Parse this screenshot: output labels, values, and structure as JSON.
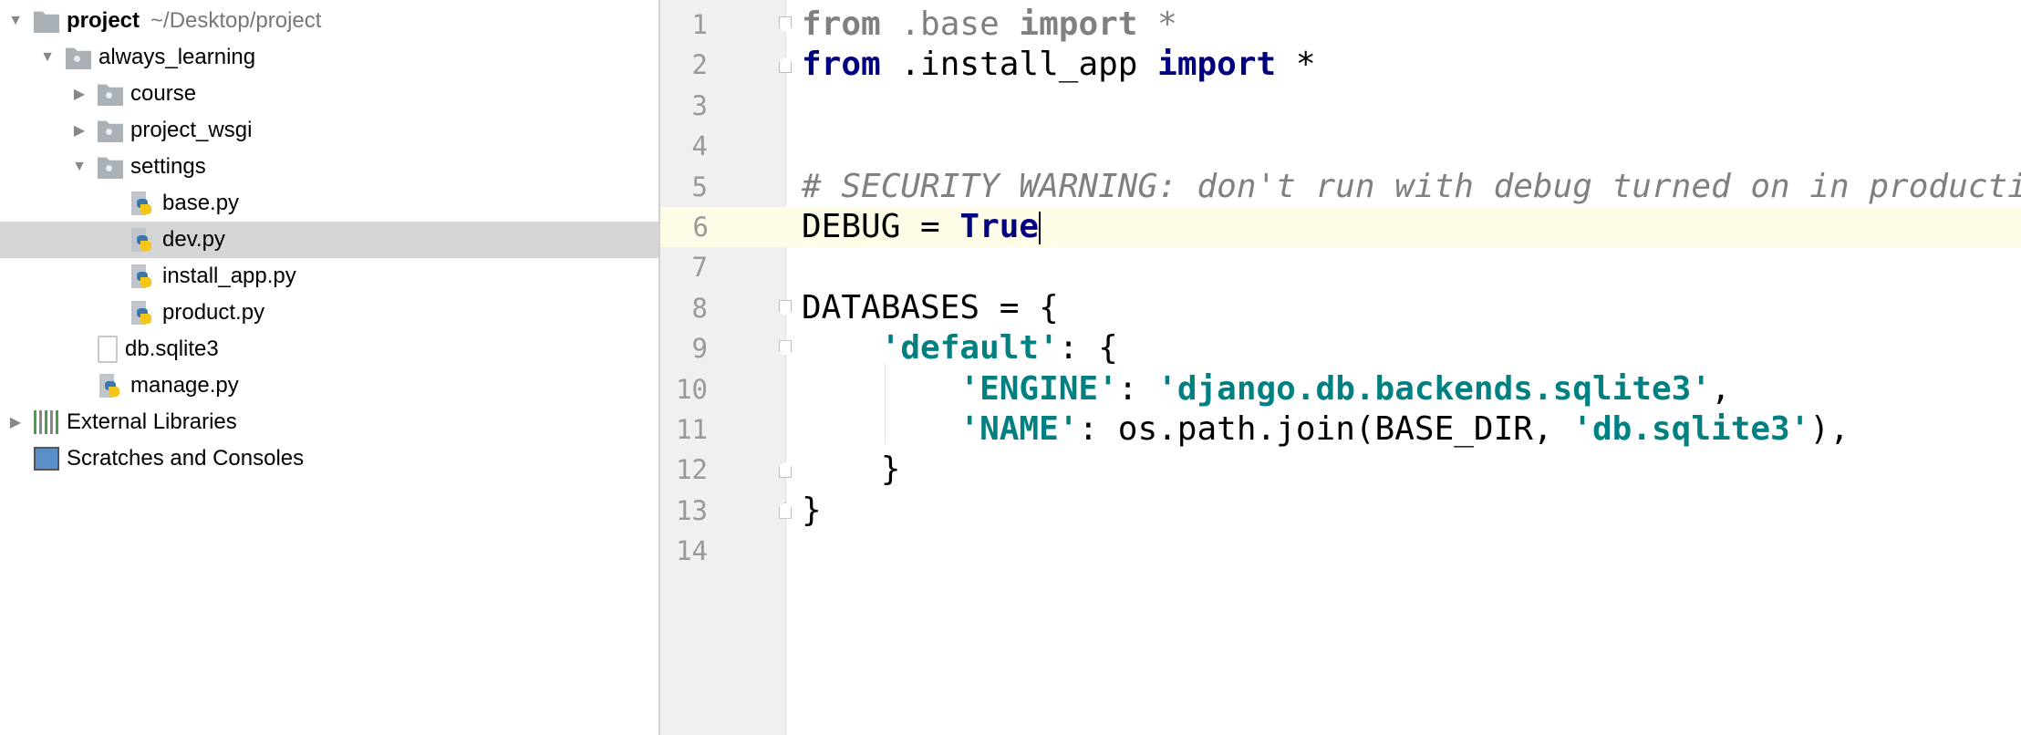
{
  "tree": [
    {
      "label": "project",
      "hint": "~/Desktop/project",
      "arrow": "▼",
      "icon": "folder-icon",
      "level": 0,
      "bold": true
    },
    {
      "label": "always_learning",
      "arrow": "▼",
      "icon": "package-folder-icon",
      "level": 1
    },
    {
      "label": "course",
      "arrow": "▶",
      "icon": "package-folder-icon",
      "level": 2
    },
    {
      "label": "project_wsgi",
      "arrow": "▶",
      "icon": "package-folder-icon",
      "level": 2
    },
    {
      "label": "settings",
      "arrow": "▼",
      "icon": "package-folder-icon",
      "level": 2
    },
    {
      "label": "base.py",
      "arrow": "",
      "icon": "python-file-icon",
      "level": 3
    },
    {
      "label": "dev.py",
      "arrow": "",
      "icon": "python-file-icon",
      "level": 3,
      "selected": true
    },
    {
      "label": "install_app.py",
      "arrow": "",
      "icon": "python-file-icon",
      "level": 3
    },
    {
      "label": "product.py",
      "arrow": "",
      "icon": "python-file-icon",
      "level": 3
    },
    {
      "label": "db.sqlite3",
      "arrow": "",
      "icon": "file-icon",
      "level": 2
    },
    {
      "label": "manage.py",
      "arrow": "",
      "icon": "python-file-icon",
      "level": 2
    },
    {
      "label": "External Libraries",
      "arrow": "▶",
      "icon": "libraries-icon",
      "level": 0
    },
    {
      "label": "Scratches and Consoles",
      "arrow": "",
      "icon": "scratches-icon",
      "level": 0
    }
  ],
  "editor": {
    "current_line": 6,
    "lines": [
      [
        [
          "kwg",
          "from"
        ],
        [
          "gray",
          " .base "
        ],
        [
          "kwg",
          "import"
        ],
        [
          "gray",
          " *"
        ]
      ],
      [
        [
          "kw",
          "from"
        ],
        [
          "",
          " .install_app "
        ],
        [
          "kw",
          "import"
        ],
        [
          "",
          " *"
        ]
      ],
      [],
      [],
      [
        [
          "cm",
          "# SECURITY WARNING: don't run with debug turned on in production!"
        ]
      ],
      [
        [
          "",
          "DEBUG = "
        ],
        [
          "kw",
          "True"
        ]
      ],
      [],
      [
        [
          "",
          "DATABASES = {"
        ]
      ],
      [
        [
          "",
          "    "
        ],
        [
          "str",
          "'default'"
        ],
        [
          "",
          ": {"
        ]
      ],
      [
        [
          "",
          "        "
        ],
        [
          "str",
          "'ENGINE'"
        ],
        [
          "",
          ": "
        ],
        [
          "str",
          "'django.db.backends.sqlite3'"
        ],
        [
          "",
          ","
        ]
      ],
      [
        [
          "",
          "        "
        ],
        [
          "str",
          "'NAME'"
        ],
        [
          "",
          ": os.path.join(BASE_DIR, "
        ],
        [
          "str",
          "'db.sqlite3'"
        ],
        [
          "",
          "),"
        ]
      ],
      [
        [
          "",
          "    }"
        ]
      ],
      [
        [
          "",
          "}"
        ]
      ],
      []
    ]
  }
}
